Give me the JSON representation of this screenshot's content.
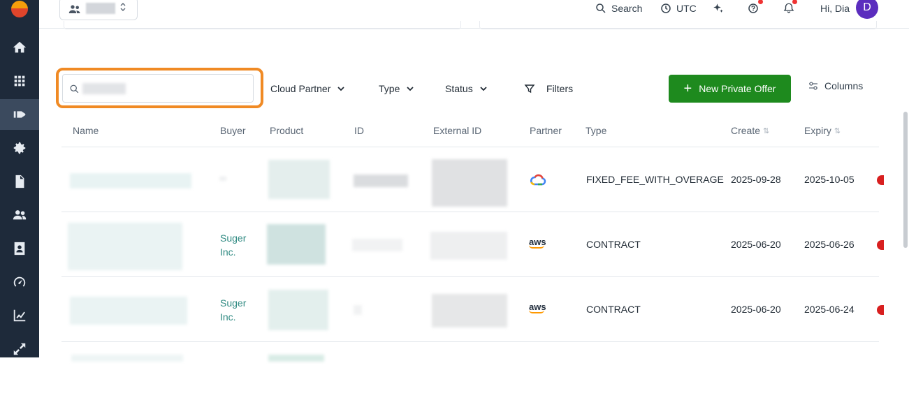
{
  "topbar": {
    "search_label": "Search",
    "timezone_label": "UTC",
    "greeting": "Hi, Dia",
    "avatar_initial": "D"
  },
  "toolbar": {
    "search_placeholder": "",
    "cloud_partner_label": "Cloud Partner",
    "type_label": "Type",
    "status_label": "Status",
    "filters_label": "Filters",
    "new_offer_label": "New Private Offer",
    "columns_label": "Columns"
  },
  "table": {
    "headers": {
      "name": "Name",
      "buyer": "Buyer",
      "product": "Product",
      "id": "ID",
      "external_id": "External ID",
      "partner": "Partner",
      "type": "Type",
      "create": "Create",
      "expiry": "Expiry"
    },
    "rows": [
      {
        "buyer": "",
        "partner": "gcp",
        "type": "FIXED_FEE_WITH_OVERAGE",
        "create": "2025-09-28",
        "expiry": "2025-10-05"
      },
      {
        "buyer_line1": "Suger",
        "buyer_line2": "Inc.",
        "partner": "aws",
        "type": "CONTRACT",
        "create": "2025-06-20",
        "expiry": "2025-06-26"
      },
      {
        "buyer_line1": "Suger",
        "buyer_line2": "Inc.",
        "partner": "aws",
        "type": "CONTRACT",
        "create": "2025-06-20",
        "expiry": "2025-06-24"
      }
    ]
  },
  "aws_text": "aws",
  "colors": {
    "sidebar": "#1e2a3a",
    "primary": "#1e8a1e",
    "highlight": "#f08a24",
    "link": "#2f8a82",
    "avatar": "#5b2dbe"
  }
}
